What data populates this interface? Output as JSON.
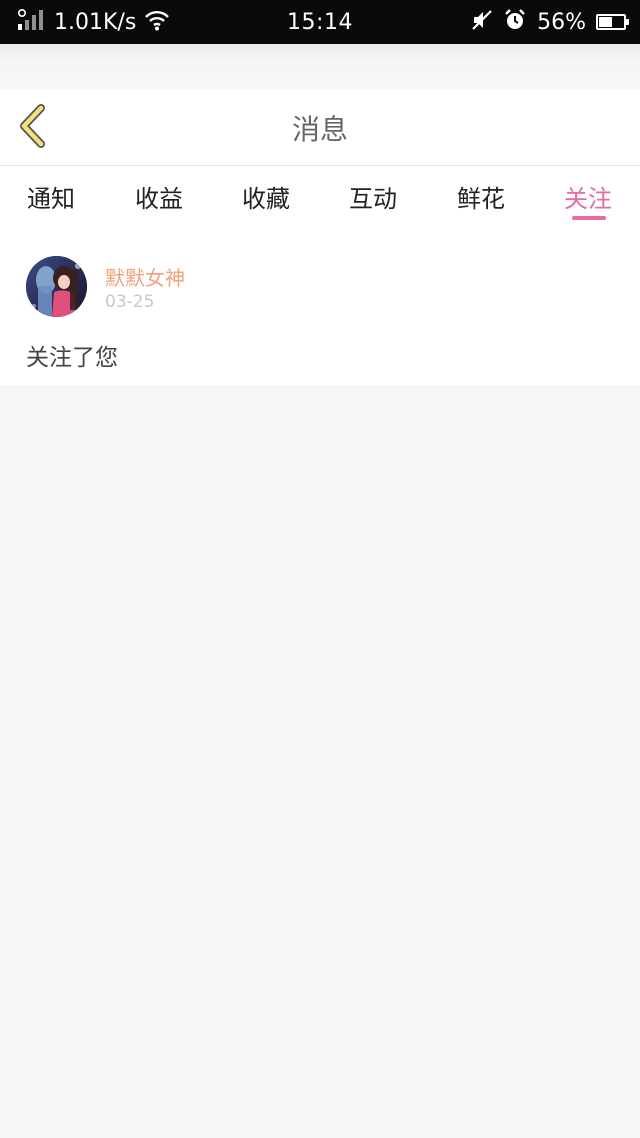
{
  "status_bar": {
    "net_speed": "1.01K/s",
    "time": "15:14",
    "battery_text": "56%",
    "battery_level": 0.56,
    "icons": [
      "signal-icon",
      "wifi-icon",
      "mute-icon",
      "alarm-icon",
      "battery-icon"
    ]
  },
  "header": {
    "title": "消息",
    "back_icon": "chevron-left-icon",
    "back_icon_color": "#f2e27a"
  },
  "tabs": {
    "items": [
      {
        "label": "通知"
      },
      {
        "label": "收益"
      },
      {
        "label": "收藏"
      },
      {
        "label": "互动"
      },
      {
        "label": "鲜花"
      },
      {
        "label": "关注"
      }
    ],
    "active_index": 5,
    "active_color": "#e86aa4"
  },
  "messages": [
    {
      "user_name": "默默女神",
      "date": "03-25",
      "text": "关注了您",
      "avatar": "avatar-image"
    }
  ],
  "colors": {
    "background": "#f7f7f7",
    "name_color": "#f0a27a",
    "date_color": "#c8c8c8"
  }
}
